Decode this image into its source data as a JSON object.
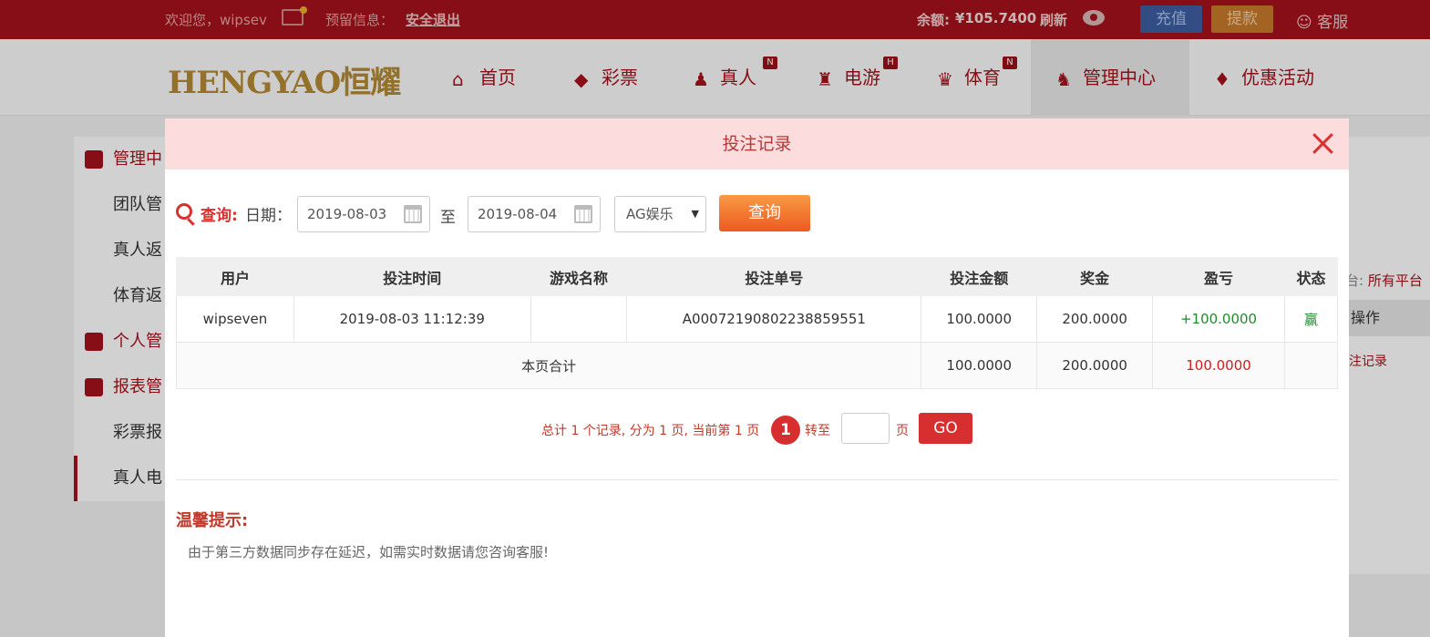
{
  "topbar": {
    "welcome": "欢迎您，wipsev",
    "reserved": "预留信息：",
    "logout": "安全退出",
    "balance_label": "余额:",
    "balance_value": "¥105.7400",
    "refresh": "刷新",
    "deposit": "充值",
    "withdraw": "提款",
    "service": "客服"
  },
  "navbar": {
    "logo": "HENGYAO恒耀",
    "items": [
      {
        "label": "首页",
        "icon": "home-icon",
        "badge": ""
      },
      {
        "label": "彩票",
        "icon": "ticket-icon",
        "badge": ""
      },
      {
        "label": "真人",
        "icon": "person-icon",
        "badge": "N"
      },
      {
        "label": "电游",
        "icon": "slot-icon",
        "badge": "H"
      },
      {
        "label": "体育",
        "icon": "trophy-icon",
        "badge": "N"
      },
      {
        "label": "管理中心",
        "icon": "users-icon",
        "badge": ""
      },
      {
        "label": "优惠活动",
        "icon": "gift-icon",
        "badge": ""
      }
    ]
  },
  "sidebar": {
    "items": [
      {
        "label": "管理中"
      },
      {
        "label": "团队管"
      },
      {
        "label": "真人返"
      },
      {
        "label": "体育返"
      },
      {
        "label": "个人管"
      },
      {
        "label": "报表管"
      },
      {
        "label": "彩票报"
      },
      {
        "label": "真人电"
      }
    ]
  },
  "background_right": {
    "platform_label": "台:",
    "platform_value": "所有平台",
    "op_header": "操作",
    "op_link": "注记录"
  },
  "modal": {
    "title": "投注记录",
    "query_label": "查询:",
    "date_label": "日期：",
    "date_from": "2019-08-03",
    "to_label": "至",
    "date_to": "2019-08-04",
    "platform_selected": "AG娱乐",
    "query_button": "查询",
    "table": {
      "headers": [
        "用户",
        "投注时间",
        "游戏名称",
        "投注单号",
        "投注金额",
        "奖金",
        "盈亏",
        "状态"
      ],
      "rows": [
        [
          "wipseven",
          "2019-08-03 11:12:39",
          "",
          "A0007219080223885955​1",
          "100.0000",
          "200.0000",
          "+100.0000",
          "赢"
        ]
      ],
      "summary": {
        "label": "本页合计",
        "bet": "100.0000",
        "bonus": "200.0000",
        "profit": "100.0000"
      }
    },
    "pager": {
      "text": "总计 1 个记录, 分为 1 页, 当前第 1 页",
      "current": "1",
      "goto": "转至",
      "unit": "页",
      "go": "GO"
    },
    "tip_title": "温馨提示:",
    "tip_text": "由于第三方数据同步存在延迟，如需实时数据请您咨询客服!"
  },
  "colors": {
    "brand": "#a5121b",
    "accent": "#d72f2f",
    "profit": "#22892e"
  }
}
